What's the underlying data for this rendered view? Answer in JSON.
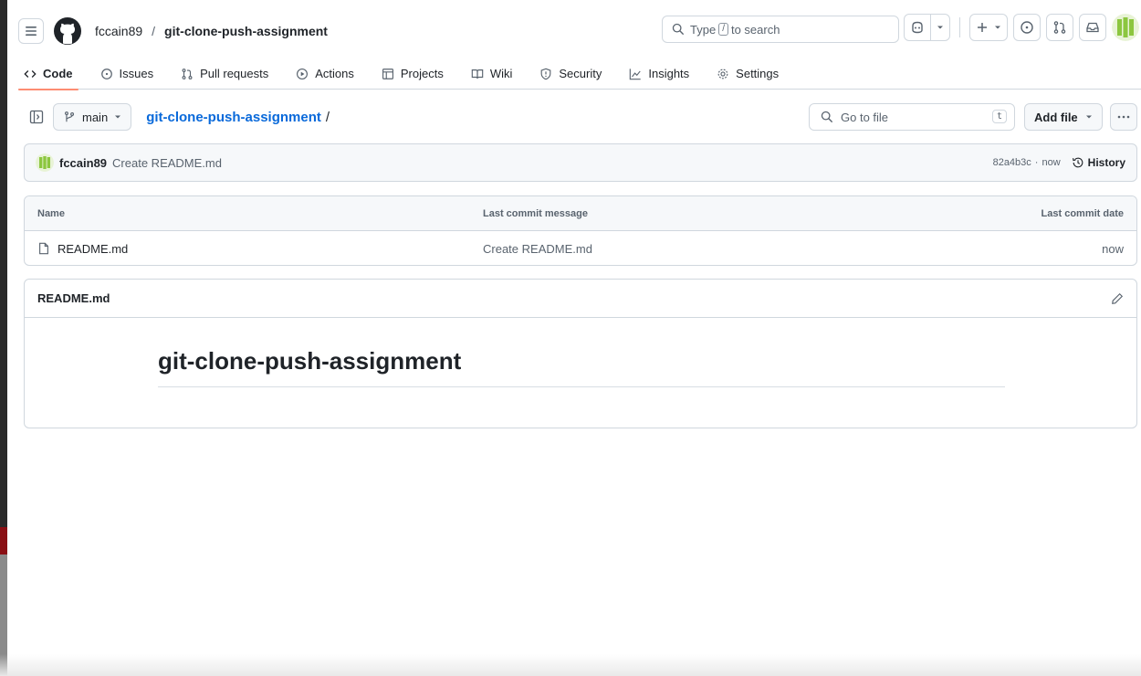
{
  "header": {
    "owner": "fccain89",
    "separator": "/",
    "repo": "git-clone-push-assignment",
    "search_placeholder_before": "Type",
    "search_key": "/",
    "search_placeholder_after": "to search"
  },
  "tabs": [
    {
      "label": "Code",
      "icon": "code-icon",
      "active": true
    },
    {
      "label": "Issues",
      "icon": "issue-icon"
    },
    {
      "label": "Pull requests",
      "icon": "pull-request-icon"
    },
    {
      "label": "Actions",
      "icon": "play-icon"
    },
    {
      "label": "Projects",
      "icon": "table-icon"
    },
    {
      "label": "Wiki",
      "icon": "book-icon"
    },
    {
      "label": "Security",
      "icon": "shield-icon"
    },
    {
      "label": "Insights",
      "icon": "graph-icon"
    },
    {
      "label": "Settings",
      "icon": "gear-icon"
    }
  ],
  "toolbar": {
    "branch": "main",
    "repo_link": "git-clone-push-assignment",
    "path_sep": "/",
    "goto_placeholder": "Go to file",
    "goto_key": "t",
    "add_file": "Add file"
  },
  "commit": {
    "author": "fccain89",
    "message": "Create README.md",
    "sha": "82a4b3c",
    "dot": "·",
    "time": "now",
    "history": "History"
  },
  "files": {
    "headers": {
      "name": "Name",
      "message": "Last commit message",
      "date": "Last commit date"
    },
    "rows": [
      {
        "name": "README.md",
        "message": "Create README.md",
        "date": "now"
      }
    ]
  },
  "readme": {
    "filename": "README.md",
    "heading": "git-clone-push-assignment"
  },
  "colors": {
    "accent_link": "#0969da",
    "active_tab_underline": "#fd8c73",
    "border": "#d0d7de",
    "avatar_green": "#8cc63f"
  }
}
